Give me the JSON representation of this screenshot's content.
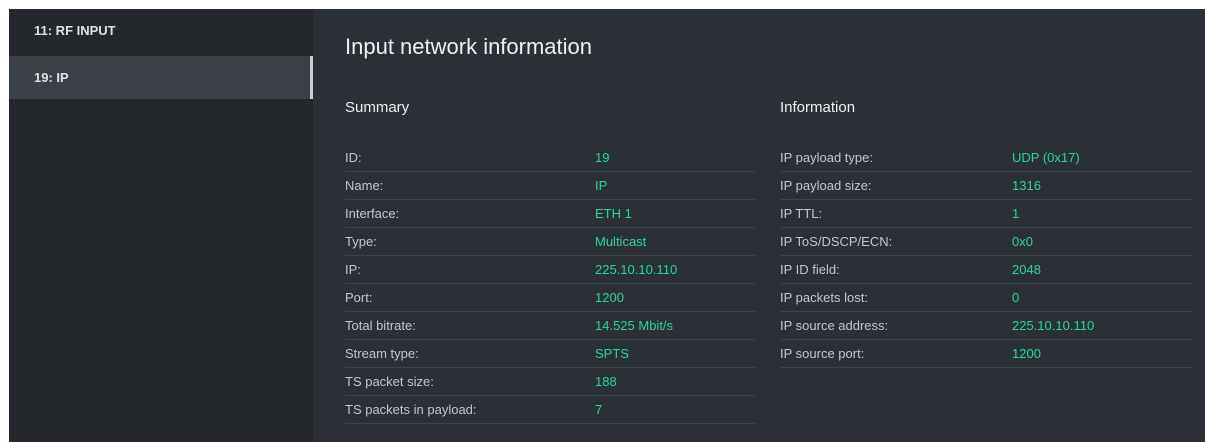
{
  "sidebar": {
    "items": [
      {
        "label": "11: RF INPUT",
        "active": false
      },
      {
        "label": "19: IP",
        "active": true
      }
    ]
  },
  "main": {
    "title": "Input network information",
    "summary": {
      "title": "Summary",
      "rows": [
        {
          "label": "ID:",
          "value": "19"
        },
        {
          "label": "Name:",
          "value": "IP"
        },
        {
          "label": "Interface:",
          "value": "ETH 1"
        },
        {
          "label": "Type:",
          "value": "Multicast"
        },
        {
          "label": "IP:",
          "value": "225.10.10.110"
        },
        {
          "label": "Port:",
          "value": "1200"
        },
        {
          "label": "Total bitrate:",
          "value": "14.525 Mbit/s"
        },
        {
          "label": "Stream type:",
          "value": "SPTS"
        },
        {
          "label": "TS packet size:",
          "value": "188"
        },
        {
          "label": "TS packets in payload:",
          "value": "7"
        }
      ]
    },
    "information": {
      "title": "Information",
      "rows": [
        {
          "label": "IP payload type:",
          "value": "UDP (0x17)"
        },
        {
          "label": "IP payload size:",
          "value": "1316"
        },
        {
          "label": "IP TTL:",
          "value": "1"
        },
        {
          "label": "IP ToS/DSCP/ECN:",
          "value": "0x0"
        },
        {
          "label": "IP ID field:",
          "value": "2048"
        },
        {
          "label": "IP packets lost:",
          "value": "0"
        },
        {
          "label": "IP source address:",
          "value": "225.10.10.110"
        },
        {
          "label": "IP source port:",
          "value": "1200"
        }
      ]
    }
  },
  "colors": {
    "background": "#2b3036",
    "sidebar": "#24282d",
    "active_item": "#3b4047",
    "value_accent": "#2bd69a"
  }
}
